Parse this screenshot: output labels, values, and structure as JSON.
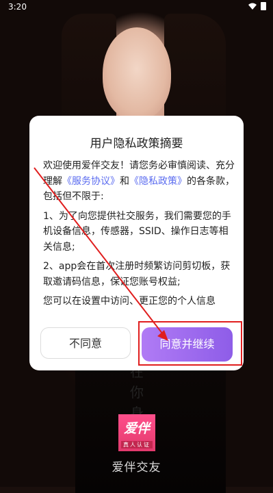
{
  "status_bar": {
    "time": "3:20"
  },
  "dialog": {
    "title": "用户隐私政策摘要",
    "para1_prefix": "欢迎使用爱伴交友！请您务必审慎阅读、充分理解",
    "link_service": "《服务协议》",
    "para1_and": "和",
    "link_privacy": "《隐私政策》",
    "para1_suffix": "的各条款，包括但不限于:",
    "para2": "1、为了向您提供社交服务，我们需要您的手机设备信息，传感器，SSID、操作日志等相关信息;",
    "para3": "2、app会在首次注册时频繁访问剪切板，获取邀请码信息，保证您账号权益;",
    "para4": "您可以在设置中访问、更正您的个人信息",
    "disagree_label": "不同意",
    "agree_label": "同意并继续"
  },
  "background": {
    "slogan": [
      "在",
      "你",
      "身"
    ],
    "logo_text": "爱伴",
    "logo_badge": "真人认证",
    "app_name": "爱伴交友"
  },
  "annotation": {
    "highlight_color": "#e01e1e"
  }
}
